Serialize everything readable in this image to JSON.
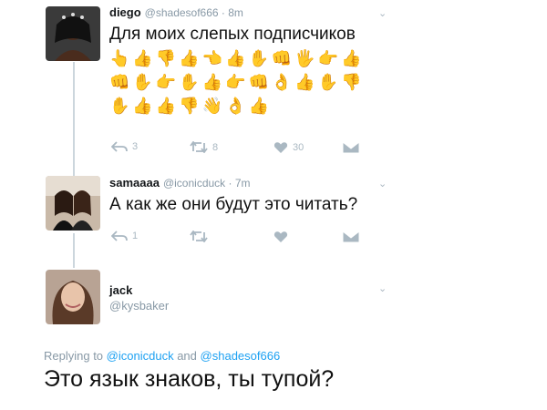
{
  "tweets": [
    {
      "name": "diego",
      "handle": "@shadesof666",
      "time": "8m",
      "text": "Для моих слепых подписчиков",
      "emoji_rows": [
        "👆👍👎👍👈👍✋👊🖐👉👍",
        "👊✋👉✋👍👉👊👌👍✋👎",
        "✋👍👍👎👋👌👍"
      ],
      "actions": {
        "reply_count": "3",
        "retweet_count": "8",
        "like_count": "30"
      }
    },
    {
      "name": "samaaaa",
      "handle": "@iconicduck",
      "time": "7m",
      "text": "А как же они будут это читать?",
      "actions": {
        "reply_count": "1",
        "retweet_count": "",
        "like_count": ""
      }
    },
    {
      "name": "jack",
      "handle": "@kysbaker"
    }
  ],
  "reply": {
    "replying_prefix": "Replying to",
    "mention1": "@iconicduck",
    "and_word": "and",
    "mention2": "@shadesof666",
    "text": "Это язык знаков, ты тупой?"
  },
  "colors": {
    "muted": "#8899a6",
    "link": "#1da1f2",
    "line": "#ccd6dd"
  }
}
